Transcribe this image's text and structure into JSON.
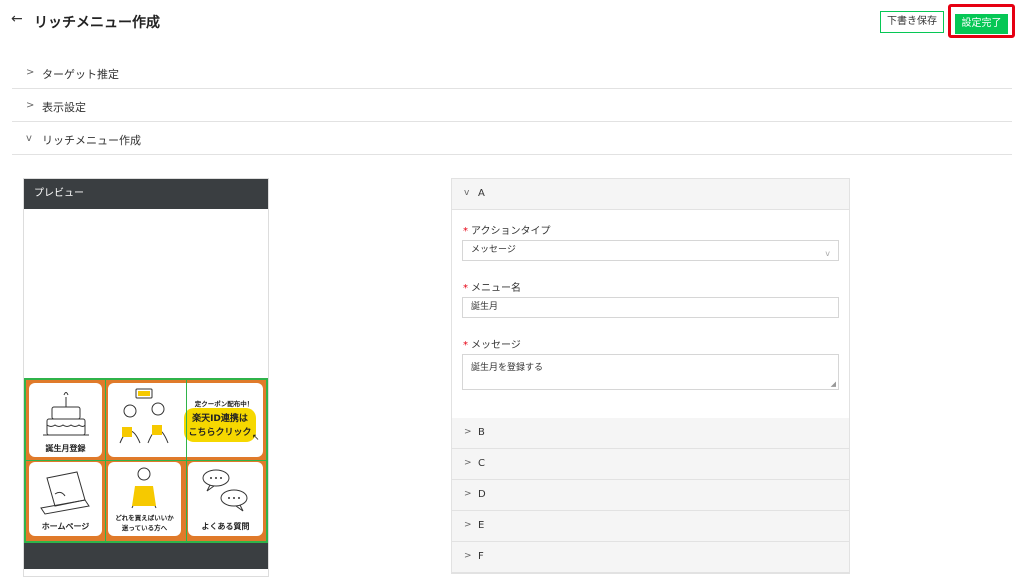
{
  "header": {
    "title": "リッチメニュー作成",
    "draft_label": "下書き保存",
    "done_label": "設定完了"
  },
  "sections": [
    {
      "label": "ターゲット推定",
      "state": "collapsed"
    },
    {
      "label": "表示設定",
      "state": "collapsed"
    },
    {
      "label": "リッチメニュー作成",
      "state": "expanded"
    }
  ],
  "preview": {
    "title": "プレビュー",
    "cells": [
      {
        "caption": "誕生月登録"
      },
      {
        "caption": ""
      },
      {
        "caption": "定クーポン配布中！",
        "banner": "楽天ID連携は",
        "banner2": "こちらクリック"
      },
      {
        "caption": "ホームページ"
      },
      {
        "caption": "どれを買えばいいか",
        "caption2": "迷っている方へ"
      },
      {
        "caption": "よくある質問"
      }
    ]
  },
  "form": {
    "active_tab": "A",
    "action_type_label": "アクションタイプ",
    "action_type_value": "メッセージ",
    "menu_name_label": "メニュー名",
    "menu_name_value": "誕生月",
    "message_label": "メッセージ",
    "message_value": "誕生月を登録する",
    "collapsed_tabs": [
      "B",
      "C",
      "D",
      "E",
      "F"
    ]
  },
  "colors": {
    "primary": "#06c755",
    "highlight": "#e60012",
    "preview_bar": "#3a3e41",
    "tile_border": "#e07a2a"
  }
}
